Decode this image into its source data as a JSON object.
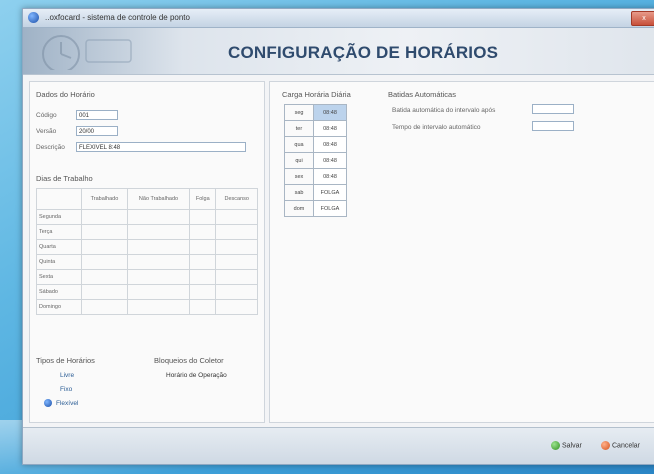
{
  "window": {
    "title": "..oxfocard - sistema de controle de ponto",
    "close_label": "x"
  },
  "banner": {
    "title": "CONFIGURAÇÃO DE HORÁRIOS"
  },
  "left": {
    "section_dados": "Dados do Horário",
    "codigo_label": "Código",
    "codigo_value": "001",
    "versao_label": "Versão",
    "versao_value": "20/00",
    "descricao_label": "Descrição",
    "descricao_value": "FLEXIVEL 8:48",
    "section_dias": "Dias de Trabalho",
    "grid_headers": [
      "Trabalhado",
      "Não Trabalhado",
      "Folga",
      "Descanso"
    ],
    "days": [
      "Segunda",
      "Terça",
      "Quarta",
      "Quinta",
      "Sexta",
      "Sábado",
      "Domingo"
    ],
    "section_tipos": "Tipos de Horários",
    "tipos": [
      "Livre",
      "Fixo"
    ],
    "tipo_selected": "Flexível",
    "section_bloqueios": "Bloqueios do Coletor",
    "bloqueio_item": "Horário de Operação"
  },
  "right": {
    "section_carga": "Carga Horária Diária",
    "carga_rows": [
      {
        "day": "seg",
        "value": "08:48"
      },
      {
        "day": "ter",
        "value": "08:48"
      },
      {
        "day": "qua",
        "value": "08:48"
      },
      {
        "day": "qui",
        "value": "08:48"
      },
      {
        "day": "sex",
        "value": "08:48"
      },
      {
        "day": "sab",
        "value": "FOLGA"
      },
      {
        "day": "dom",
        "value": "FOLGA"
      }
    ],
    "section_batidas": "Batidas Automáticas",
    "batida_label_1": "Batida automática do intervalo após",
    "batida_label_2": "Tempo de intervalo automático"
  },
  "footer": {
    "salvar_label": "Salvar",
    "cancelar_label": "Cancelar"
  },
  "colors": {
    "banner_title": "#2f4b6e",
    "accent": "#2b5d95",
    "desktop": "#3d9fd8"
  }
}
